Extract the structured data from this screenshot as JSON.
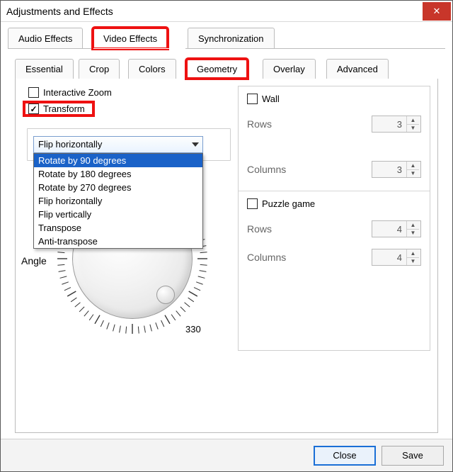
{
  "window": {
    "title": "Adjustments and Effects",
    "closeGlyph": "✕"
  },
  "mainTabs": {
    "audio": "Audio Effects",
    "video": "Video Effects",
    "sync": "Synchronization",
    "active": "video"
  },
  "subTabs": {
    "essential": "Essential",
    "crop": "Crop",
    "colors": "Colors",
    "geometry": "Geometry",
    "overlay": "Overlay",
    "advanced": "Advanced",
    "active": "geometry"
  },
  "left": {
    "interactiveZoom": {
      "label": "Interactive Zoom",
      "checked": false
    },
    "transform": {
      "label": "Transform",
      "checked": true
    },
    "dropdown": {
      "selected": "Flip horizontally",
      "highlightIndex": 0,
      "options": [
        "Rotate by 90 degrees",
        "Rotate by 180 degrees",
        "Rotate by 270 degrees",
        "Flip horizontally",
        "Flip vertically",
        "Transpose",
        "Anti-transpose"
      ]
    },
    "angle": {
      "label": "Angle",
      "tickLabel": "330"
    }
  },
  "right": {
    "wall": {
      "label": "Wall",
      "checked": false,
      "rowsLabel": "Rows",
      "rows": "3",
      "colsLabel": "Columns",
      "cols": "3"
    },
    "puzzle": {
      "label": "Puzzle game",
      "checked": false,
      "rowsLabel": "Rows",
      "rows": "4",
      "colsLabel": "Columns",
      "cols": "4"
    }
  },
  "footer": {
    "close": "Close",
    "save": "Save"
  },
  "highlight": {
    "color": "#e11919"
  }
}
